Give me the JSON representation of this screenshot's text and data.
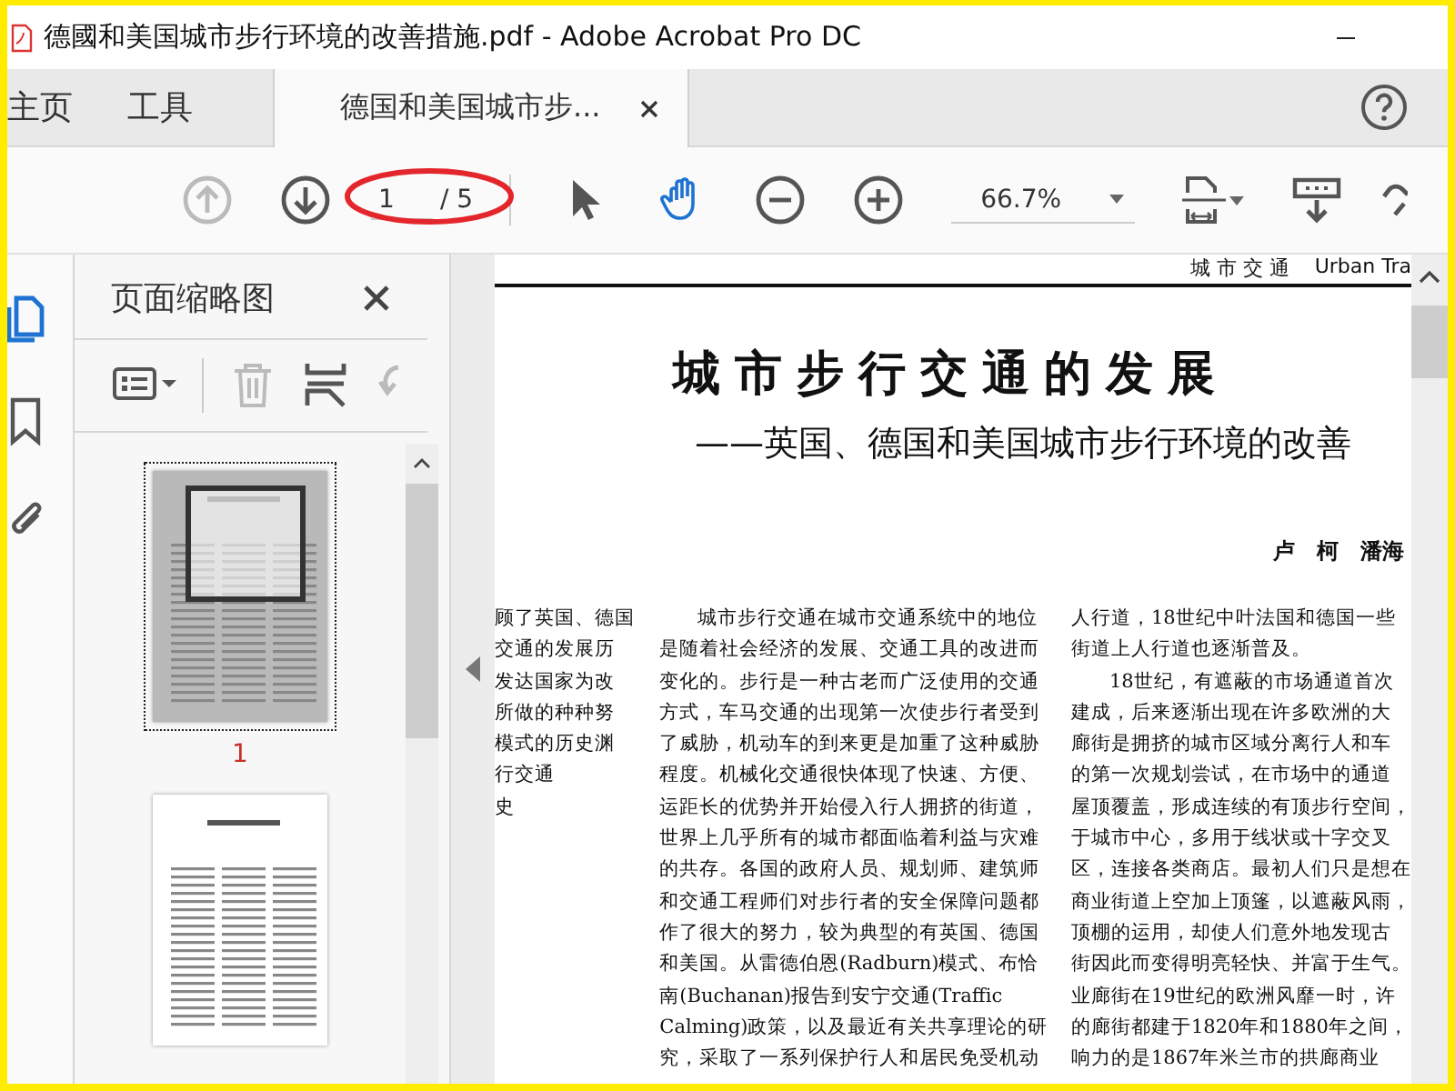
{
  "window": {
    "title": "德國和美国城市步行环境的改善措施.pdf - Adobe Acrobat Pro DC"
  },
  "tabs": [
    {
      "label": "主页",
      "kind": "nav",
      "selected": false
    },
    {
      "label": "工具",
      "kind": "nav",
      "selected": false
    },
    {
      "label": "德国和美国城市步...",
      "kind": "document",
      "selected": true
    }
  ],
  "toolbar": {
    "previous_page": {
      "disabled": true
    },
    "next_page": {
      "disabled": false
    },
    "page_field": {
      "value": "1"
    },
    "page_total": "/ 5",
    "tools": [
      {
        "kind": "select",
        "selected": false
      },
      {
        "kind": "hand",
        "selected": true
      },
      {
        "kind": "zoom-out",
        "selected": false
      },
      {
        "kind": "zoom-in",
        "selected": false
      }
    ],
    "zoom_field": {
      "value": "66.7%"
    }
  },
  "markup": [
    {
      "kind": "ellipse"
    }
  ],
  "left_rail": [
    {
      "kind": "pages",
      "selected": true
    },
    {
      "kind": "bookmarks",
      "selected": false
    },
    {
      "kind": "attachments",
      "selected": false
    }
  ],
  "thumbnails_panel": {
    "title": "页面缩略图",
    "tools": [
      {
        "kind": "options",
        "disabled": false
      },
      {
        "kind": "delete",
        "disabled": true
      },
      {
        "kind": "insert",
        "disabled": false
      },
      {
        "kind": "rotate",
        "disabled": true
      }
    ],
    "pages": [
      {
        "label": "1",
        "selected": true
      },
      {
        "selected": false
      }
    ]
  },
  "document": {
    "running_header": "城 市 交 通",
    "running_header_en": "Urban Tra",
    "title": "城市步行交通的发展",
    "subtitle": "——英国、德国和美国城市步行环境的改善",
    "authors": "卢　柯　潘海",
    "column_1": [
      {
        "text": "顾了英国、德国",
        "indent": false
      },
      {
        "text": "交通的发展历",
        "indent": false
      },
      {
        "text": "发达国家为改",
        "indent": false
      },
      {
        "text": "所做的种种努",
        "indent": false
      },
      {
        "text": "模式的历史渊",
        "indent": false
      },
      {
        "text": "行交通",
        "indent": false
      },
      {
        "text": "史",
        "indent": false
      }
    ],
    "column_2": [
      {
        "text": "城市步行交通在城市交通系统中的地位",
        "indent": true
      },
      {
        "text": "是随着社会经济的发展、交通工具的改进而",
        "indent": false
      },
      {
        "text": "变化的。步行是一种古老而广泛使用的交通",
        "indent": false
      },
      {
        "text": "方式，车马交通的出现第一次使步行者受到",
        "indent": false
      },
      {
        "text": "了威胁，机动车的到来更是加重了这种威胁",
        "indent": false
      },
      {
        "text": "程度。机械化交通很快体现了快速、方便、",
        "indent": false
      },
      {
        "text": "运距长的优势并开始侵入行人拥挤的街道，",
        "indent": false
      },
      {
        "text": "世界上几乎所有的城市都面临着利益与灾难",
        "indent": false
      },
      {
        "text": "的共存。各国的政府人员、规划师、建筑师",
        "indent": false
      },
      {
        "text": "和交通工程师们对步行者的安全保障问题都",
        "indent": false
      },
      {
        "text": "作了很大的努力，较为典型的有英国、德国",
        "indent": false
      },
      {
        "text": "和美国。从雷德伯恩(Radburn)模式、布恰",
        "indent": false
      },
      {
        "text": "南(Buchanan)报告到安宁交通(Traffic",
        "indent": false
      },
      {
        "text": "Calming)政策，以及最近有关共享理论的研",
        "indent": false
      },
      {
        "text": "究，采取了一系列保护行人和居民免受机动",
        "indent": false
      }
    ],
    "column_3": [
      {
        "text": "人行道，18世纪中叶法国和德国一些",
        "indent": false
      },
      {
        "text": "街道上人行道也逐渐普及。",
        "indent": false
      },
      {
        "text": "18世纪，有遮蔽的市场通道首次",
        "indent": true
      },
      {
        "text": "建成，后来逐渐出现在许多欧洲的大",
        "indent": false
      },
      {
        "text": "廊街是拥挤的城市区域分离行人和车",
        "indent": false
      },
      {
        "text": "的第一次规划尝试，在市场中的通道",
        "indent": false
      },
      {
        "text": "屋顶覆盖，形成连续的有顶步行空间，",
        "indent": false
      },
      {
        "text": "于城市中心，多用于线状或十字交叉",
        "indent": false
      },
      {
        "text": "区，连接各类商店。最初人们只是想在",
        "indent": false
      },
      {
        "text": "商业街道上空加上顶篷，以遮蔽风雨，",
        "indent": false
      },
      {
        "text": "顶棚的运用，却使人们意外地发现古",
        "indent": false
      },
      {
        "text": "街因此而变得明亮轻快、并富于生气。",
        "indent": false
      },
      {
        "text": "业廊街在19世纪的欧洲风靡一时，许",
        "indent": false
      },
      {
        "text": "的廊街都建于1820年和1880年之间，",
        "indent": false
      },
      {
        "text": "响力的是1867年米兰市的拱廊商业",
        "indent": false
      }
    ]
  }
}
